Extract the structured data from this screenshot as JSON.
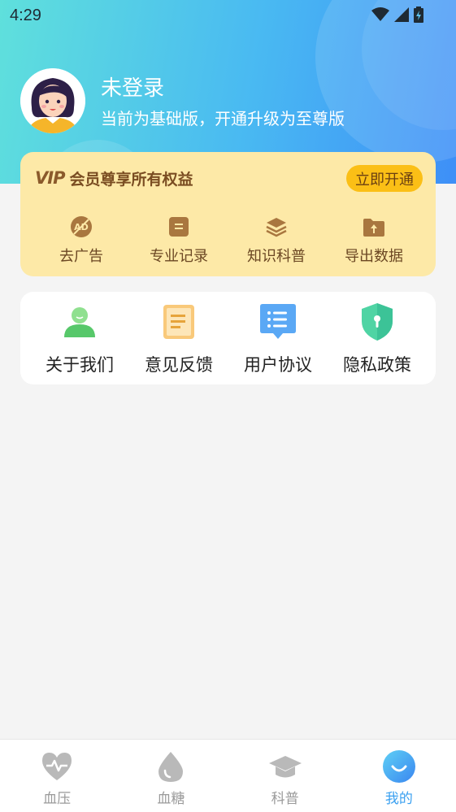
{
  "status_bar": {
    "time": "4:29"
  },
  "user": {
    "name": "未登录",
    "subtitle": "当前为基础版，开通升级为至尊版"
  },
  "vip": {
    "logo": "VIP",
    "title": "会员尊享所有权益",
    "button_label": "立即开通",
    "items": [
      {
        "label": "去广告",
        "icon": "ad-free-icon"
      },
      {
        "label": "专业记录",
        "icon": "record-icon"
      },
      {
        "label": "知识科普",
        "icon": "knowledge-icon"
      },
      {
        "label": "导出数据",
        "icon": "export-icon"
      }
    ]
  },
  "tools": [
    {
      "label": "关于我们",
      "icon": "person-icon"
    },
    {
      "label": "意见反馈",
      "icon": "feedback-icon"
    },
    {
      "label": "用户协议",
      "icon": "agreement-icon"
    },
    {
      "label": "隐私政策",
      "icon": "privacy-shield-icon"
    }
  ],
  "tabbar": {
    "active": "我的",
    "tabs": [
      {
        "label": "血压",
        "icon": "heart-icon"
      },
      {
        "label": "血糖",
        "icon": "drop-icon"
      },
      {
        "label": "科普",
        "icon": "graduation-cap-icon"
      },
      {
        "label": "我的",
        "icon": "smile-icon"
      }
    ]
  },
  "colors": {
    "accent": "#3aa0f0",
    "vip_bg": "#fde9a7",
    "vip_button": "#fbbf16",
    "inactive": "#9a9a9a"
  }
}
